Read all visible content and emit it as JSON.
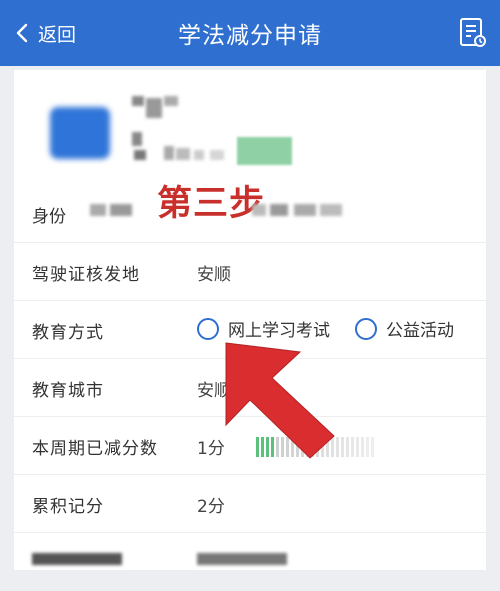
{
  "nav": {
    "back_label": "返回",
    "title": "学法减分申请",
    "doc_icon": "document-list-icon",
    "back_icon": "chevron-left-icon"
  },
  "annotation": {
    "step_label": "第三步"
  },
  "profile": {
    "id_label": "身份"
  },
  "rows": {
    "license_place": {
      "label": "驾驶证核发地",
      "value": "安顺"
    },
    "education_mode": {
      "label": "教育方式",
      "options": [
        "网上学习考试",
        "公益活动"
      ],
      "selected": null
    },
    "education_city": {
      "label": "教育城市",
      "value": "安顺"
    },
    "period_deducted": {
      "label": "本周期已减分数",
      "value": "1分",
      "progress_fraction": 0.17
    },
    "accumulated_points": {
      "label": "累积记分",
      "value": "2分"
    }
  },
  "colors": {
    "nav_bg": "#2f6fd0",
    "accent": "#2f6fd0",
    "annotation_red": "#c9302c",
    "progress_green": "#5cbf7a"
  }
}
